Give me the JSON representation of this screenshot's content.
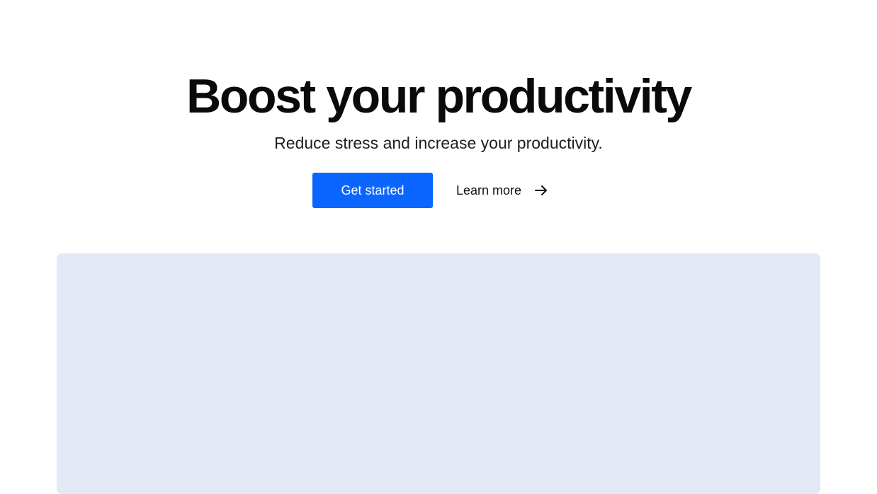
{
  "hero": {
    "title": "Boost your productivity",
    "subtitle": "Reduce stress and increase your productivity."
  },
  "actions": {
    "primary_label": "Get started",
    "secondary_label": "Learn more",
    "secondary_icon": "arrow-right-icon"
  },
  "colors": {
    "primary": "#0a66ff",
    "panel": "#e3e9f5",
    "text": "#0a0a0a"
  }
}
